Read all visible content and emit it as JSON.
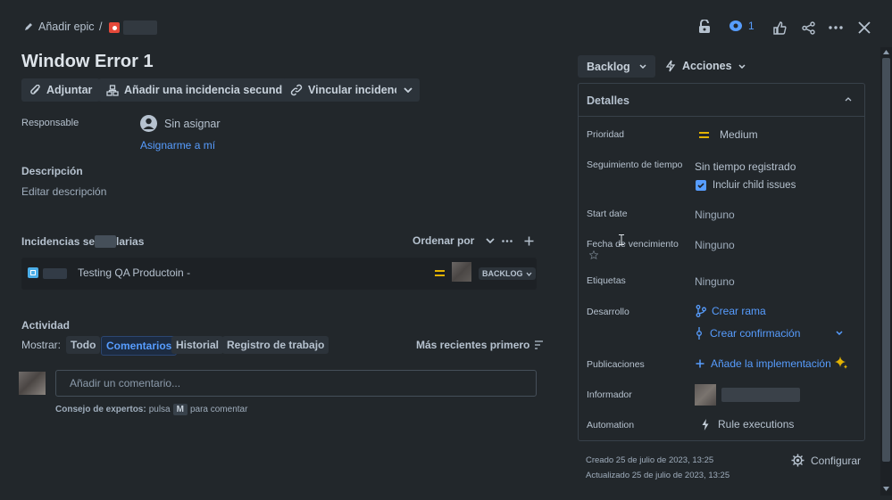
{
  "topbar": {
    "add_epic": "Añadir epic",
    "separator": "/",
    "watch_count": "1"
  },
  "issue": {
    "title": "Window Error 1"
  },
  "actions": {
    "attach": "Adjuntar",
    "add_child": "Añadir una incidencia secundaria",
    "link": "Vincular incidencia"
  },
  "assignee": {
    "label": "Responsable",
    "value": "Sin asignar",
    "assign_me": "Asignarme a mí"
  },
  "description": {
    "heading": "Descripción",
    "placeholder": "Editar descripción"
  },
  "child_issues": {
    "heading_start": "Incidencias se",
    "heading_end": "larias",
    "order_by": "Ordenar por",
    "items": [
      {
        "summary": "Testing QA Productoin -",
        "status": "BACKLOG"
      }
    ]
  },
  "activity": {
    "heading": "Actividad",
    "show_label": "Mostrar:",
    "filters": [
      "Todo",
      "Comentarios",
      "Historial",
      "Registro de trabajo"
    ],
    "active_filter": "Comentarios",
    "sort": "Más recientes primero",
    "comment_placeholder": "Añadir un comentario...",
    "tip_bold": "Consejo de expertos:",
    "tip_text": "pulsa",
    "tip_key": "M",
    "tip_end": "para comentar"
  },
  "status_button": "Backlog",
  "actions_button": "Acciones",
  "details": {
    "heading": "Detalles",
    "priority": {
      "label": "Prioridad",
      "value": "Medium"
    },
    "time_tracking": {
      "label": "Seguimiento de tiempo",
      "value": "Sin tiempo registrado",
      "checkbox": "Incluir child issues"
    },
    "start_date": {
      "label": "Start date",
      "value": "Ninguno"
    },
    "due_date": {
      "label_start": "Fecha de",
      "label_end": "vencimiento",
      "value": "Ninguno"
    },
    "labels": {
      "label": "Etiquetas",
      "value": "Ninguno"
    },
    "development": {
      "label": "Desarrollo",
      "create_branch": "Crear rama",
      "create_commit": "Crear confirmación"
    },
    "releases": {
      "label": "Publicaciones",
      "value": "Añade la implementación"
    },
    "reporter": {
      "label": "Informador"
    },
    "automation": {
      "label": "Automation",
      "value": "Rule executions"
    }
  },
  "footer": {
    "created": "Creado 25 de julio de 2023, 13:25",
    "updated": "Actualizado 25 de julio de 2023, 13:25",
    "configure": "Configurar"
  },
  "colors": {
    "background": "#22272b",
    "link": "#579dff",
    "priority_medium": "#e2b203",
    "ai_sparkle": "#e2b203"
  }
}
